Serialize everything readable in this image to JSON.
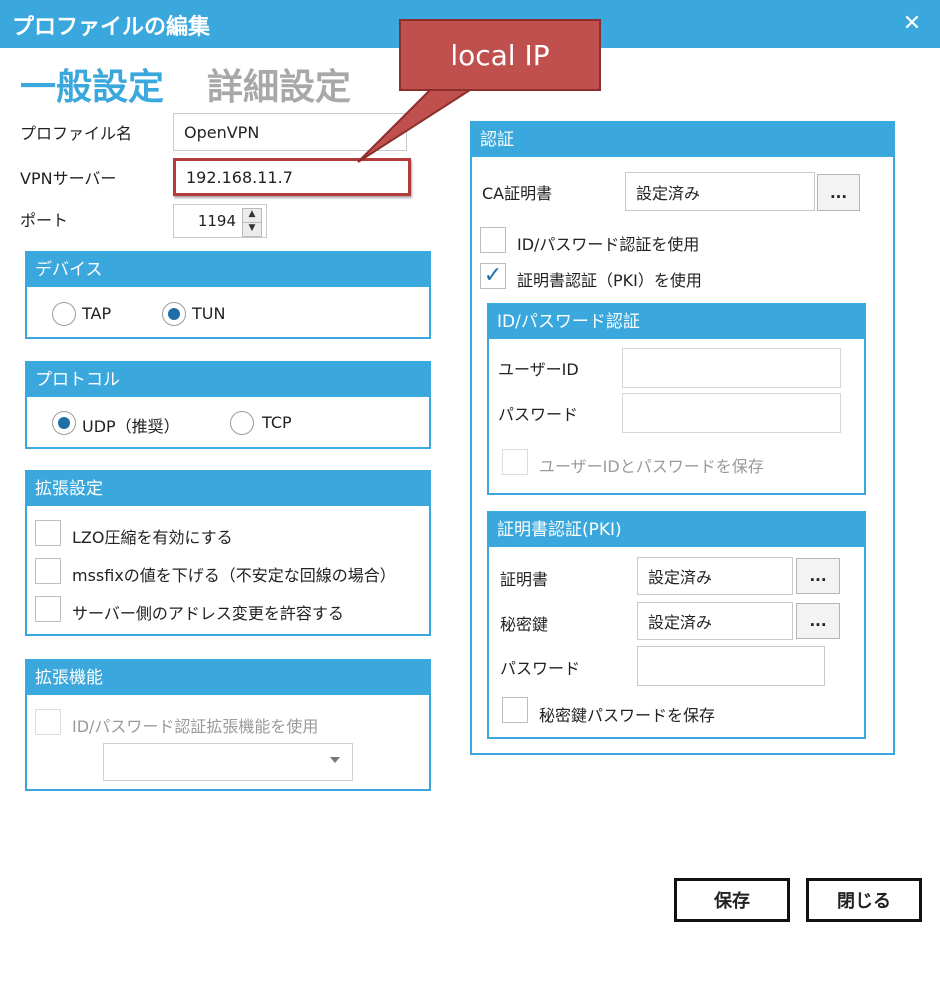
{
  "window": {
    "title": "プロファイルの編集",
    "close_icon": "close-icon"
  },
  "tabs": {
    "general": "一般設定",
    "advanced": "詳細設定"
  },
  "form": {
    "profile_name_label": "プロファイル名",
    "profile_name_value": "OpenVPN",
    "vpn_server_label": "VPNサーバー",
    "vpn_server_value": "192.168.11.7",
    "port_label": "ポート",
    "port_value": "1194"
  },
  "device": {
    "header": "デバイス",
    "options": [
      "TAP",
      "TUN"
    ],
    "selected": "TUN"
  },
  "protocol": {
    "header": "プロトコル",
    "options": [
      "UDP（推奨）",
      "TCP"
    ],
    "selected": "UDP（推奨）"
  },
  "extended_settings": {
    "header": "拡張設定",
    "items": [
      "LZO圧縮を有効にする",
      "mssfixの値を下げる（不安定な回線の場合）",
      "サーバー側のアドレス変更を許容する"
    ]
  },
  "extended_features": {
    "header": "拡張機能",
    "checkbox_label": "ID/パスワード認証拡張機能を使用",
    "dropdown_value": ""
  },
  "auth": {
    "header": "認証",
    "ca_label": "CA証明書",
    "ca_value": "設定済み",
    "browse_label": "...",
    "use_id_password": "ID/パスワード認証を使用",
    "use_pki": "証明書認証（PKI）を使用",
    "idpw_group": {
      "header": "ID/パスワード認証",
      "user_id_label": "ユーザーID",
      "password_label": "パスワード",
      "save_label": "ユーザーIDとパスワードを保存"
    },
    "pki_group": {
      "header": "証明書認証(PKI)",
      "cert_label": "証明書",
      "cert_value": "設定済み",
      "key_label": "秘密鍵",
      "key_value": "設定済み",
      "password_label": "パスワード",
      "save_key_password": "秘密鍵パスワードを保存"
    }
  },
  "buttons": {
    "save": "保存",
    "close": "閉じる"
  },
  "callout": {
    "text": "local IP",
    "color": "#c0504d"
  },
  "colors": {
    "accent": "#3aa8dc",
    "radio_selected": "#1e6fa8",
    "highlight_border": "#b23b3b"
  }
}
